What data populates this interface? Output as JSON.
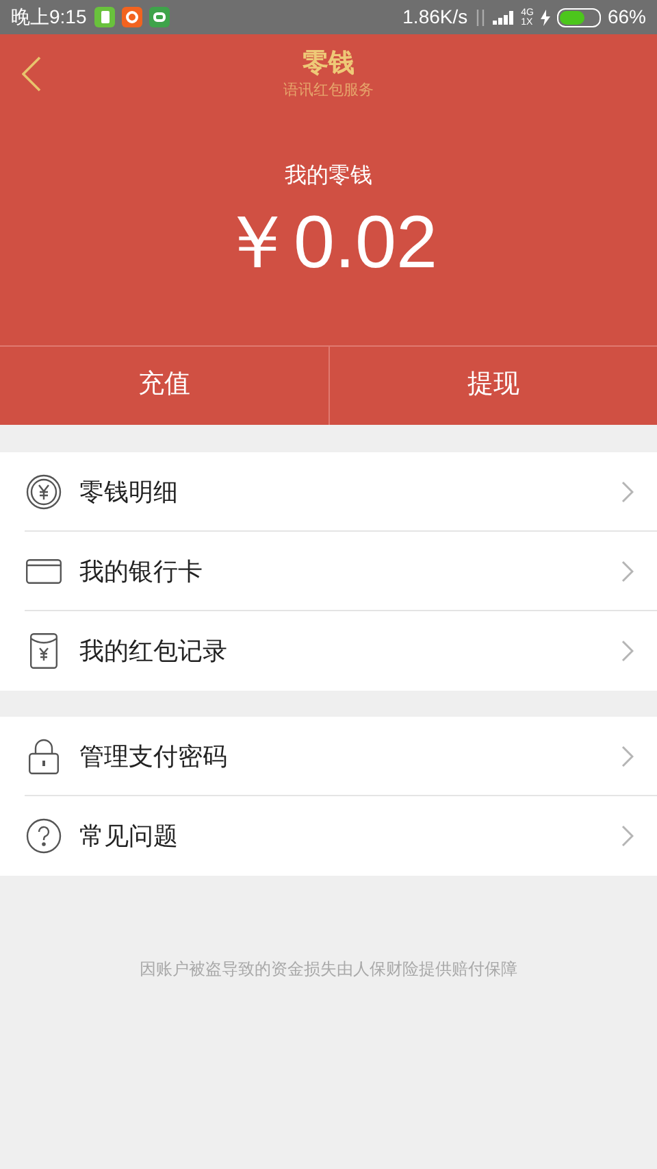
{
  "status_bar": {
    "time": "晚上9:15",
    "speed": "1.86K/s",
    "network_top": "4G",
    "network_bottom": "1X",
    "battery": "66%"
  },
  "header": {
    "title": "零钱",
    "subtitle": "语讯红包服务"
  },
  "balance": {
    "label": "我的零钱",
    "amount": "￥0.02"
  },
  "actions": [
    "充值",
    "提现"
  ],
  "groups": [
    [
      {
        "kind": "coin",
        "label": "零钱明细"
      },
      {
        "kind": "card",
        "label": "我的银行卡"
      },
      {
        "kind": "envelope",
        "label": "我的红包记录"
      }
    ],
    [
      {
        "kind": "lock",
        "label": "管理支付密码"
      },
      {
        "kind": "help",
        "label": "常见问题"
      }
    ]
  ],
  "footer": "因账户被盗导致的资金损失由人保财险提供赔付保障"
}
